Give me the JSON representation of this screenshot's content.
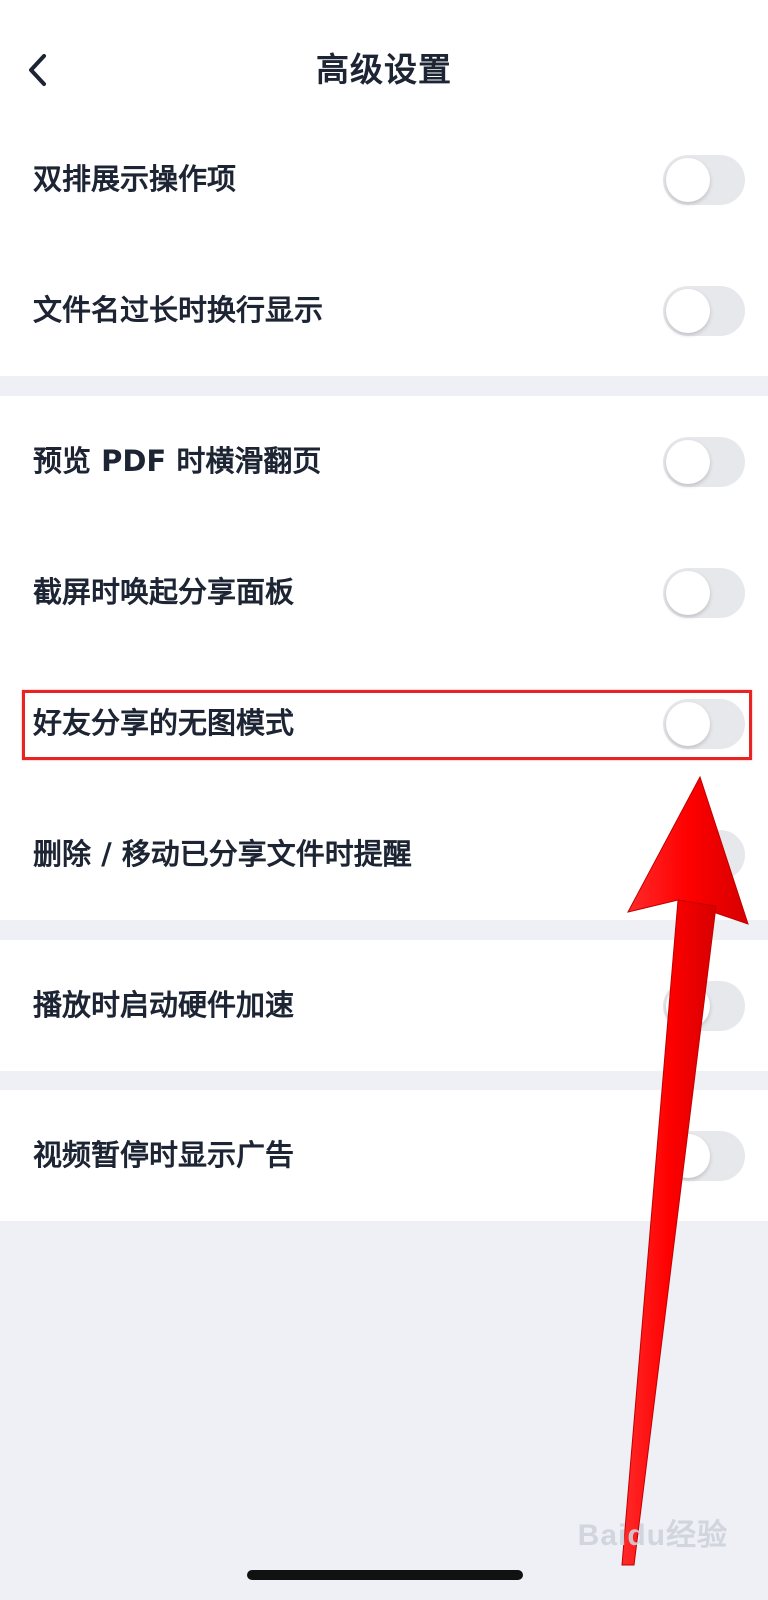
{
  "header": {
    "title": "高级设置",
    "back_icon": "chevron-left-icon"
  },
  "groups": [
    {
      "items": [
        {
          "label": "双排展示操作项",
          "enabled": false
        },
        {
          "label": "文件名过长时换行显示",
          "enabled": false
        }
      ]
    },
    {
      "items": [
        {
          "label": "预览 PDF 时横滑翻页",
          "enabled": false
        },
        {
          "label": "截屏时唤起分享面板",
          "enabled": false
        },
        {
          "label": "好友分享的无图模式",
          "enabled": false
        },
        {
          "label": "删除 / 移动已分享文件时提醒",
          "enabled": false
        }
      ]
    },
    {
      "items": [
        {
          "label": "播放时启动硬件加速",
          "enabled": false
        }
      ]
    },
    {
      "items": [
        {
          "label": "视频暂停时显示广告",
          "enabled": false
        }
      ]
    }
  ],
  "annotation": {
    "highlighted_item": "好友分享的无图模式",
    "highlight_color": "#e82323",
    "arrow_color": "#ff1111"
  },
  "watermark": "Baidu经验",
  "colors": {
    "background": "#eff0f5",
    "card": "#ffffff",
    "text": "#1d2433",
    "toggle_off": "#e7e8ec"
  }
}
